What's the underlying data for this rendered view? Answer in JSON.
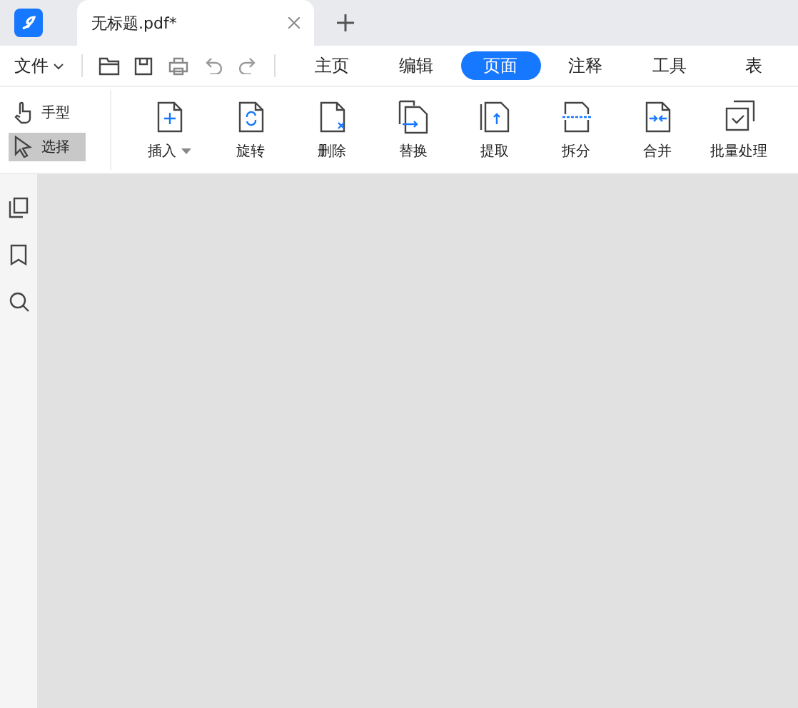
{
  "document_tab": {
    "title": "无标题.pdf*"
  },
  "file_menu": {
    "label": "文件"
  },
  "ribbon_tabs": [
    {
      "label": "主页",
      "selected": false
    },
    {
      "label": "编辑",
      "selected": false
    },
    {
      "label": "页面",
      "selected": true
    },
    {
      "label": "注释",
      "selected": false
    },
    {
      "label": "工具",
      "selected": false
    },
    {
      "label": "表",
      "selected": false
    }
  ],
  "modes": [
    {
      "kind": "hand",
      "label": "手型",
      "selected": false
    },
    {
      "kind": "select",
      "label": "选择",
      "selected": true
    }
  ],
  "tools": [
    {
      "kind": "insert",
      "label": "插入",
      "has_menu": true
    },
    {
      "kind": "rotate",
      "label": "旋转",
      "has_menu": false
    },
    {
      "kind": "delete",
      "label": "删除",
      "has_menu": false
    },
    {
      "kind": "replace",
      "label": "替换",
      "has_menu": false
    },
    {
      "kind": "extract",
      "label": "提取",
      "has_menu": false
    },
    {
      "kind": "split",
      "label": "拆分",
      "has_menu": false
    },
    {
      "kind": "merge",
      "label": "合并",
      "has_menu": false
    },
    {
      "kind": "batch",
      "label": "批量处理",
      "has_menu": false
    }
  ]
}
